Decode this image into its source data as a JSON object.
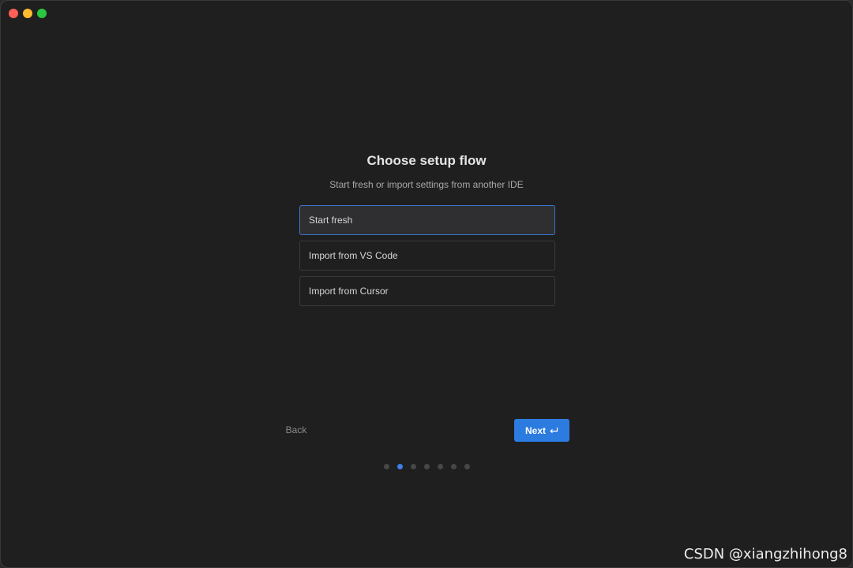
{
  "window": {
    "controls": [
      "close",
      "minimize",
      "zoom"
    ]
  },
  "setup": {
    "title": "Choose setup flow",
    "subtitle": "Start fresh or import settings from another IDE",
    "options": [
      {
        "label": "Start fresh",
        "selected": true
      },
      {
        "label": "Import from VS Code",
        "selected": false
      },
      {
        "label": "Import from Cursor",
        "selected": false
      }
    ]
  },
  "nav": {
    "back_label": "Back",
    "next_label": "Next",
    "next_icon": "return-key-icon"
  },
  "progress": {
    "total_steps": 7,
    "current_step": 2
  },
  "watermark": "CSDN @xiangzhihong8",
  "colors": {
    "accent": "#2c7be0",
    "selected_border": "#3d74cf",
    "background": "#1f1f1f"
  }
}
